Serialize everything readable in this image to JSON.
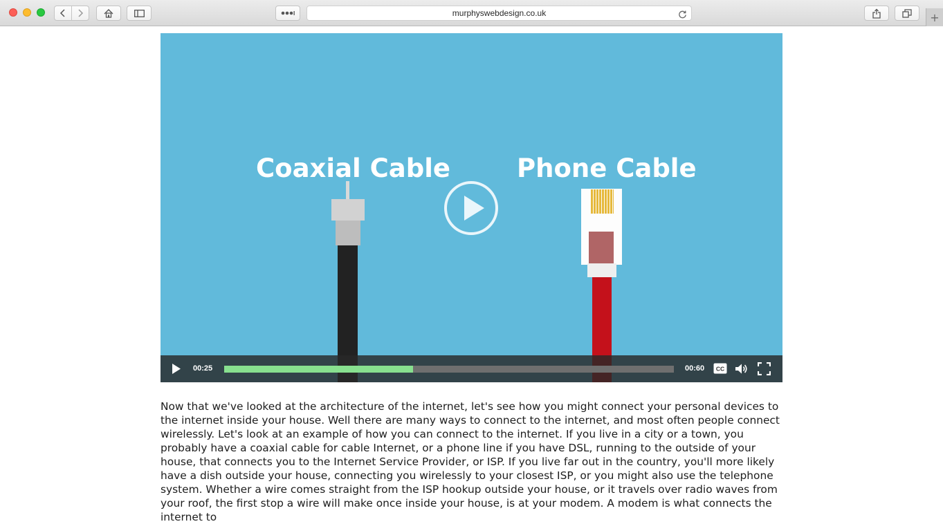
{
  "browser": {
    "url": "murphyswebdesign.co.uk",
    "new_tab_glyph": "+",
    "icons": {
      "back": "chevron-left-icon",
      "forward": "chevron-right-icon",
      "home": "home-icon",
      "sidebar": "sidebar-icon",
      "extensions": "more-dots-icon",
      "reload": "reload-icon",
      "share": "share-icon",
      "tabs": "tabs-icon"
    }
  },
  "video": {
    "heading_left": "Coaxial Cable",
    "heading_right": "Phone Cable",
    "background_color": "#61badb",
    "current_time": "00:25",
    "duration": "00:60",
    "progress_fraction": 0.42,
    "progress_color": "#88e08f",
    "cc_label": "CC"
  },
  "article": {
    "text": "Now that we've looked at the architecture of the internet, let's see how you might connect your personal devices to the internet inside your house. Well there are many ways to connect to the internet, and most often people connect wirelessly. Let's look at an example of how you can connect to the internet. If you live in a city or a town, you probably have a coaxial cable for cable Internet, or a phone line if you have DSL, running to the outside of your house, that connects you to the Internet Service Provider, or ISP. If you live far out in the country, you'll more likely have a dish outside your house, connecting you wirelessly to your closest ISP, or you might also use the telephone system. Whether a wire comes straight from the ISP hookup outside your house, or it travels over radio waves from your roof, the first stop a wire will make once inside your house, is at your modem. A modem is what connects the internet to"
  }
}
